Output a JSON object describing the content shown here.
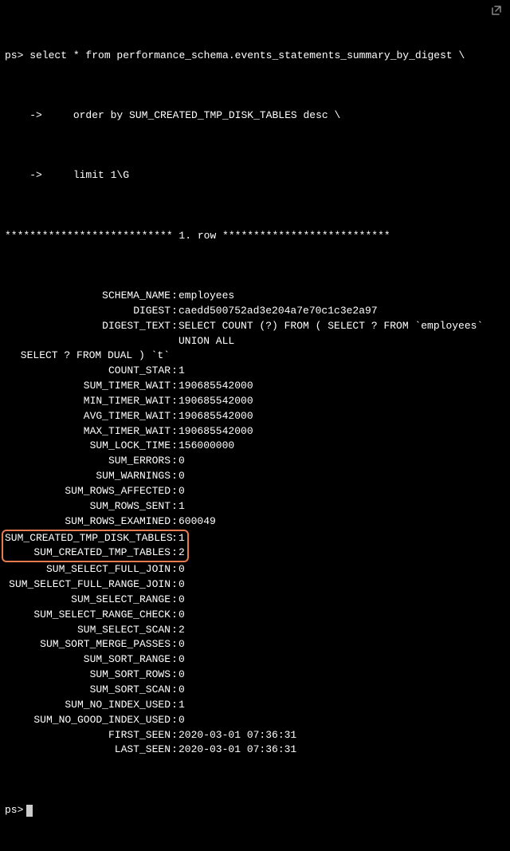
{
  "prompt": "ps>",
  "command": {
    "line1": "select * from performance_schema.events_statements_summary_by_digest \\",
    "cont_prefix": "    ->     ",
    "line2": "order by SUM_CREATED_TMP_DISK_TABLES desc \\",
    "line3": "limit 1\\G"
  },
  "row_separator": "*************************** 1. row ***************************",
  "fields": [
    {
      "k": "SCHEMA_NAME",
      "v": "employees"
    },
    {
      "k": "DIGEST",
      "v": "caedd500752ad3e204a7e70c1c3e2a97"
    },
    {
      "k": "DIGEST_TEXT",
      "v": "SELECT COUNT (?) FROM ( SELECT ? FROM `employees` UNION ALL SELECT ? FROM DUAL ) `t`"
    },
    {
      "k": "COUNT_STAR",
      "v": "1"
    },
    {
      "k": "SUM_TIMER_WAIT",
      "v": "190685542000"
    },
    {
      "k": "MIN_TIMER_WAIT",
      "v": "190685542000"
    },
    {
      "k": "AVG_TIMER_WAIT",
      "v": "190685542000"
    },
    {
      "k": "MAX_TIMER_WAIT",
      "v": "190685542000"
    },
    {
      "k": "SUM_LOCK_TIME",
      "v": "156000000"
    },
    {
      "k": "SUM_ERRORS",
      "v": "0"
    },
    {
      "k": "SUM_WARNINGS",
      "v": "0"
    },
    {
      "k": "SUM_ROWS_AFFECTED",
      "v": "0"
    },
    {
      "k": "SUM_ROWS_SENT",
      "v": "1"
    },
    {
      "k": "SUM_ROWS_EXAMINED",
      "v": "600049"
    },
    {
      "k": "SUM_CREATED_TMP_DISK_TABLES",
      "v": "1",
      "highlight": true
    },
    {
      "k": "SUM_CREATED_TMP_TABLES",
      "v": "2",
      "highlight": true
    },
    {
      "k": "SUM_SELECT_FULL_JOIN",
      "v": "0"
    },
    {
      "k": "SUM_SELECT_FULL_RANGE_JOIN",
      "v": "0"
    },
    {
      "k": "SUM_SELECT_RANGE",
      "v": "0"
    },
    {
      "k": "SUM_SELECT_RANGE_CHECK",
      "v": "0"
    },
    {
      "k": "SUM_SELECT_SCAN",
      "v": "2"
    },
    {
      "k": "SUM_SORT_MERGE_PASSES",
      "v": "0"
    },
    {
      "k": "SUM_SORT_RANGE",
      "v": "0"
    },
    {
      "k": "SUM_SORT_ROWS",
      "v": "0"
    },
    {
      "k": "SUM_SORT_SCAN",
      "v": "0"
    },
    {
      "k": "SUM_NO_INDEX_USED",
      "v": "1"
    },
    {
      "k": "SUM_NO_GOOD_INDEX_USED",
      "v": "0"
    },
    {
      "k": "FIRST_SEEN",
      "v": "2020-03-01 07:36:31"
    },
    {
      "k": "LAST_SEEN",
      "v": "2020-03-01 07:36:31"
    }
  ]
}
